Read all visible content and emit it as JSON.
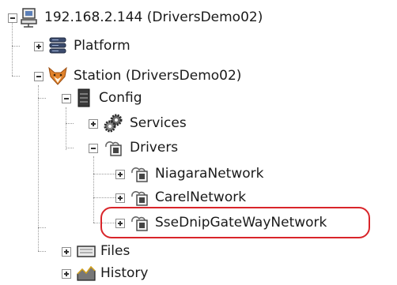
{
  "tree": {
    "root": {
      "label": "192.168.2.144 (DriversDemo02)",
      "icon": "computer-icon",
      "expanded": true
    },
    "platform": {
      "label": "Platform",
      "icon": "platform-stack-icon",
      "expanded": false
    },
    "station": {
      "label": "Station (DriversDemo02)",
      "icon": "fox-station-icon",
      "expanded": true
    },
    "config": {
      "label": "Config",
      "icon": "config-cabinet-icon",
      "expanded": true
    },
    "services": {
      "label": "Services",
      "icon": "gears-icon",
      "expanded": false
    },
    "drivers": {
      "label": "Drivers",
      "icon": "network-driver-icon",
      "expanded": true
    },
    "niagara_network": {
      "label": "NiagaraNetwork",
      "icon": "network-driver-icon",
      "expanded": false
    },
    "carel_network": {
      "label": "CarelNetwork",
      "icon": "network-driver-icon",
      "expanded": false
    },
    "sse_network": {
      "label": "SseDnipGateWayNetwork",
      "icon": "network-driver-icon",
      "expanded": false,
      "highlighted": true
    },
    "files": {
      "label": "Files",
      "icon": "folder-drive-icon",
      "expanded": false
    },
    "history": {
      "label": "History",
      "icon": "history-chart-icon",
      "expanded": false
    }
  },
  "colors": {
    "highlight": "#d9252a",
    "tree_lines": "#9a9a9a",
    "text": "#1a1a1a"
  }
}
